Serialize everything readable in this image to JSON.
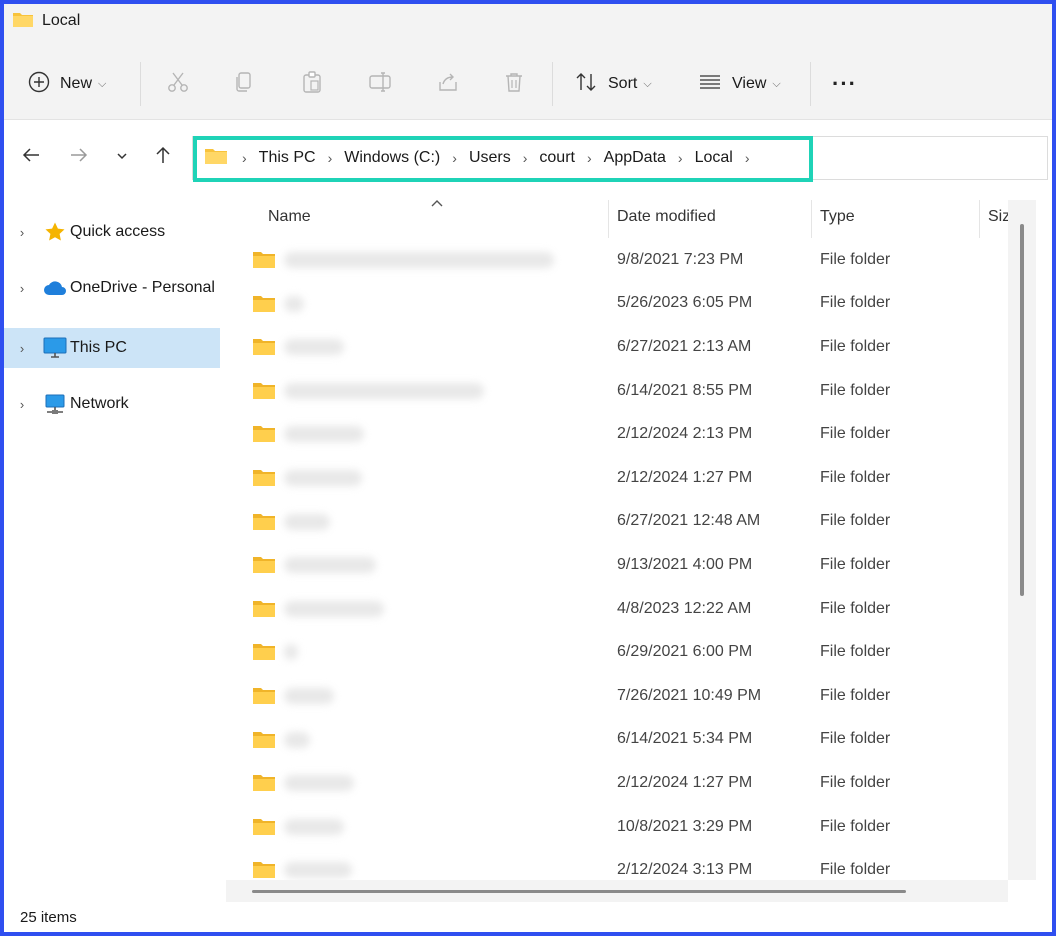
{
  "window": {
    "title": "Local"
  },
  "toolbar": {
    "new_label": "New",
    "sort_label": "Sort",
    "view_label": "View",
    "more_label": "···"
  },
  "breadcrumb": [
    "This PC",
    "Windows (C:)",
    "Users",
    "court",
    "AppData",
    "Local"
  ],
  "sidebar": {
    "items": [
      {
        "label": "Quick access",
        "icon": "star-icon"
      },
      {
        "label": "OneDrive - Personal",
        "icon": "cloud-icon"
      },
      {
        "label": "This PC",
        "icon": "monitor-icon",
        "selected": true
      },
      {
        "label": "Network",
        "icon": "network-icon"
      }
    ]
  },
  "columns": {
    "name": "Name",
    "date": "Date modified",
    "type": "Type",
    "size": "Siz"
  },
  "files": [
    {
      "date": "9/8/2021 7:23 PM",
      "type": "File folder"
    },
    {
      "date": "5/26/2023 6:05 PM",
      "type": "File folder"
    },
    {
      "date": "6/27/2021 2:13 AM",
      "type": "File folder"
    },
    {
      "date": "6/14/2021 8:55 PM",
      "type": "File folder"
    },
    {
      "date": "2/12/2024 2:13 PM",
      "type": "File folder"
    },
    {
      "date": "2/12/2024 1:27 PM",
      "type": "File folder"
    },
    {
      "date": "6/27/2021 12:48 AM",
      "type": "File folder"
    },
    {
      "date": "9/13/2021 4:00 PM",
      "type": "File folder"
    },
    {
      "date": "4/8/2023 12:22 AM",
      "type": "File folder"
    },
    {
      "date": "6/29/2021 6:00 PM",
      "type": "File folder"
    },
    {
      "date": "7/26/2021 10:49 PM",
      "type": "File folder"
    },
    {
      "date": "6/14/2021 5:34 PM",
      "type": "File folder"
    },
    {
      "date": "2/12/2024 1:27 PM",
      "type": "File folder"
    },
    {
      "date": "10/8/2021 3:29 PM",
      "type": "File folder"
    },
    {
      "date": "2/12/2024 3:13 PM",
      "type": "File folder"
    }
  ],
  "status": {
    "items_count": "25 items"
  },
  "colors": {
    "highlight_border": "#1fd3b7",
    "selected_bg": "#cce4f7",
    "folder": "#f8c33c",
    "frame": "#2f4ff0"
  }
}
